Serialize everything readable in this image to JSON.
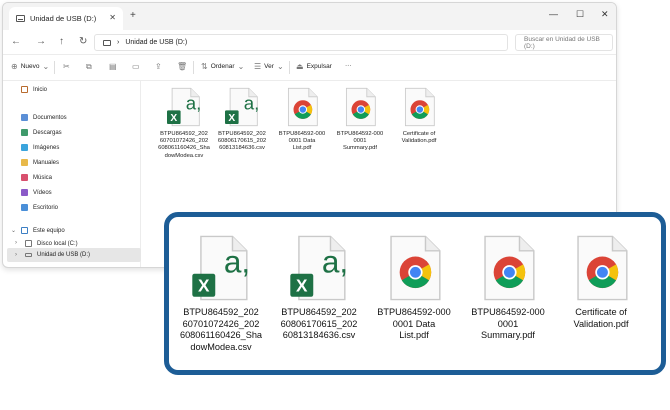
{
  "window": {
    "tab_title": "Unidad de USB (D:)",
    "close_glyph": "✕",
    "add_tab_glyph": "+",
    "minimize_glyph": "—",
    "maximize_glyph": "☐",
    "window_close_glyph": "✕"
  },
  "nav": {
    "back_glyph": "←",
    "forward_glyph": "→",
    "up_glyph": "↑",
    "refresh_glyph": "↻",
    "path_chevron": "›",
    "path": "Unidad de USB (D:)",
    "search_placeholder": "Buscar en Unidad de USB (D:)"
  },
  "toolbar": {
    "new_label": "Nuevo",
    "sort_label": "Ordenar",
    "view_label": "Ver",
    "eject_label": "Expulsar",
    "more_label": "···",
    "icons": [
      "cut-icon",
      "copy-icon",
      "paste-icon",
      "rename-icon",
      "share-icon",
      "delete-icon"
    ]
  },
  "sidebar": {
    "home": "Inicio",
    "quick": [
      "Documentos",
      "Descargas",
      "Imágenes",
      "Manuales",
      "Música",
      "Vídeos",
      "Escritorio"
    ],
    "this_pc": "Este equipo",
    "drives": [
      "Disco local (C:)",
      "Unidad de USB (D:)"
    ]
  },
  "files": [
    {
      "type": "excel",
      "name_lines": [
        "BTPU864592_202",
        "60701072426_202",
        "608061160426_Sha",
        "dowModea.csv"
      ]
    },
    {
      "type": "excel",
      "name_lines": [
        "BTPU864592_202",
        "60806170615_202",
        "60813184636.csv"
      ]
    },
    {
      "type": "pdf",
      "name_lines": [
        "BTPU864592-000",
        "0001 Data",
        "List.pdf"
      ]
    },
    {
      "type": "pdf",
      "name_lines": [
        "BTPU864592-000",
        "0001",
        "Summary.pdf"
      ]
    },
    {
      "type": "pdf",
      "name_lines": [
        "Certificate of",
        "Validation.pdf"
      ]
    }
  ],
  "colors": {
    "zoom_border": "#1d5d96",
    "wedge": "#7fb6d9",
    "excel_green": "#1e7145",
    "chrome_red": "#db4437",
    "chrome_yellow": "#f4c20d",
    "chrome_green": "#0f9d58",
    "chrome_blue": "#4285f4"
  }
}
